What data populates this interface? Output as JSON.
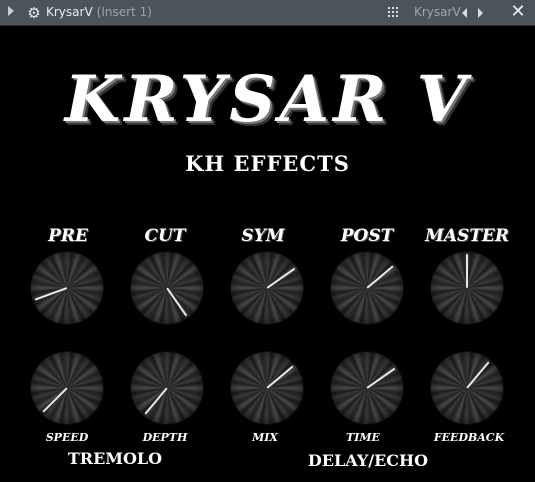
{
  "titlebar": {
    "title": "KrysarV",
    "subtitle": "(Insert 1)",
    "plugin_name": "KrysarV",
    "close_symbol": "✕"
  },
  "header": {
    "brand": "KRYSAR V",
    "subtitle": "KH EFFECTS"
  },
  "top_knobs": [
    {
      "label": "PRE",
      "angle_deg": 250
    },
    {
      "label": "CUT",
      "angle_deg": 145
    },
    {
      "label": "SYM",
      "angle_deg": 55
    },
    {
      "label": "POST",
      "angle_deg": 50
    },
    {
      "label": "MASTER",
      "angle_deg": 0
    }
  ],
  "bottom_knobs": [
    {
      "label": "SPEED",
      "angle_deg": 225
    },
    {
      "label": "DEPTH",
      "angle_deg": 220
    },
    {
      "label": "MIX",
      "angle_deg": 50
    },
    {
      "label": "TIME",
      "angle_deg": 55
    },
    {
      "label": "FEEDBACK",
      "angle_deg": 40
    }
  ],
  "groups": {
    "tremolo": "TREMOLO",
    "delay": "DELAY/ECHO"
  },
  "icons": {
    "gear": "gear-icon",
    "grid": "grid-icon",
    "close": "close-icon"
  }
}
